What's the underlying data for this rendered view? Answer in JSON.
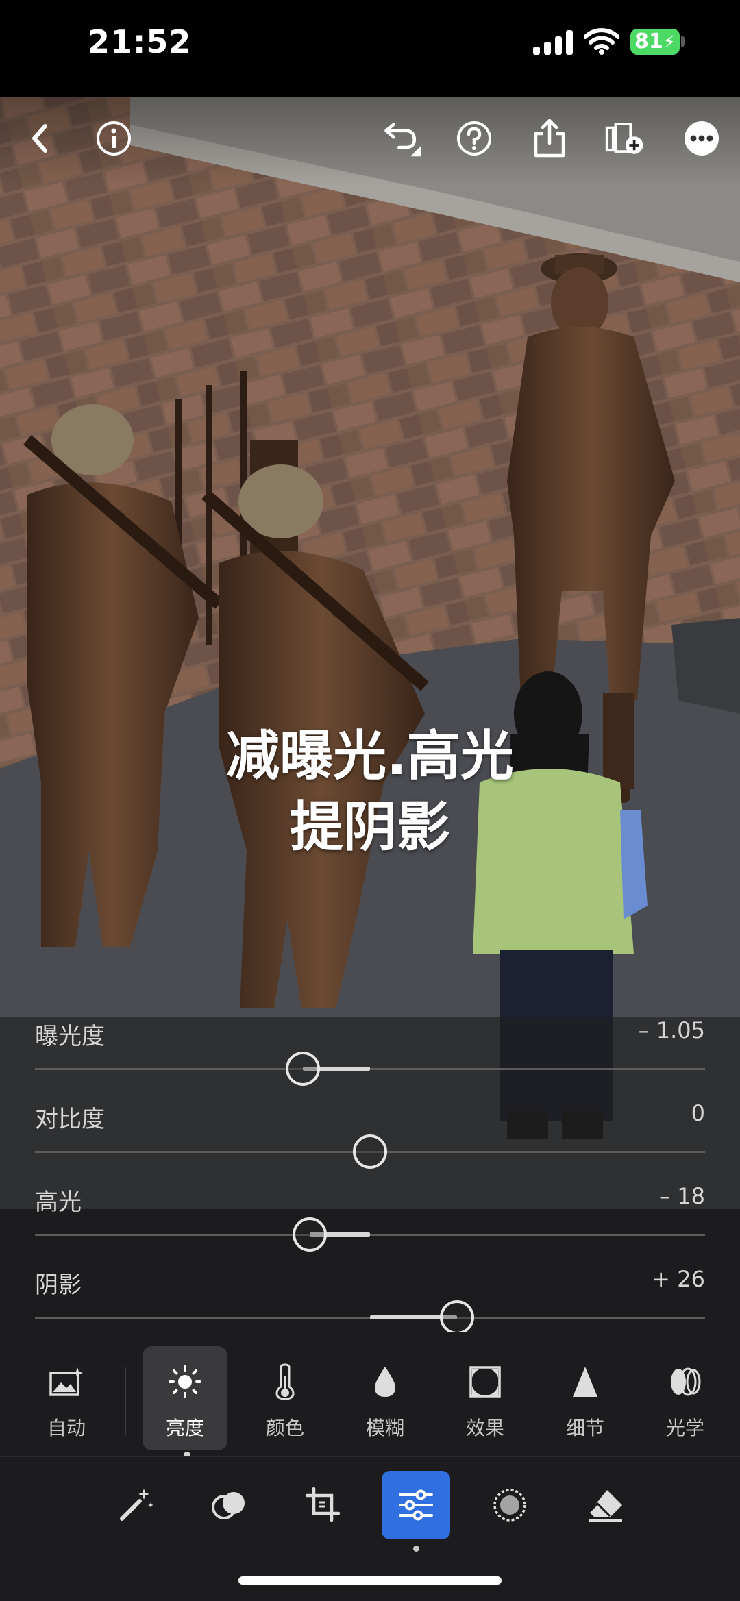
{
  "status_bar": {
    "time": "21:52",
    "battery": "81",
    "icons": [
      "signal-icon",
      "wifi-icon",
      "battery-icon"
    ]
  },
  "top_toolbar": {
    "icons": [
      "back-icon",
      "info-icon",
      "undo-icon",
      "help-icon",
      "share-icon",
      "add-to-album-icon",
      "more-icon"
    ]
  },
  "caption": {
    "line1": "减曝光.高光",
    "line2": "提阴影"
  },
  "sliders": [
    {
      "label": "曝光度",
      "value": "– 1.05",
      "position": 0.4
    },
    {
      "label": "对比度",
      "value": "0",
      "position": 0.5
    },
    {
      "label": "高光",
      "value": "– 18",
      "position": 0.41
    },
    {
      "label": "阴影",
      "value": "+ 26",
      "position": 0.63
    }
  ],
  "categories": [
    {
      "label": "自动",
      "icon": "auto-icon"
    },
    {
      "label": "亮度",
      "icon": "sun-icon",
      "active": true
    },
    {
      "label": "颜色",
      "icon": "thermometer-icon"
    },
    {
      "label": "模糊",
      "icon": "drop-icon"
    },
    {
      "label": "效果",
      "icon": "vignette-icon"
    },
    {
      "label": "细节",
      "icon": "triangle-icon"
    },
    {
      "label": "光学",
      "icon": "lens-icon"
    }
  ],
  "bottom_tools": [
    {
      "name": "magic-wand-icon"
    },
    {
      "name": "mask-icon"
    },
    {
      "name": "crop-icon"
    },
    {
      "name": "sliders-icon",
      "active": true
    },
    {
      "name": "selective-icon"
    },
    {
      "name": "eraser-icon"
    }
  ],
  "colors": {
    "accent": "#2f6fe0",
    "battery": "#4cd964",
    "panel": "#1c1c1e"
  }
}
